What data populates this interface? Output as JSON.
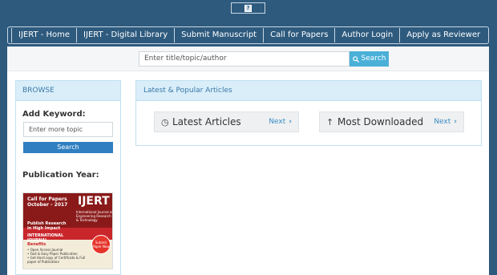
{
  "top_icon": {
    "icon": "help-icon",
    "glyph": "?"
  },
  "nav": {
    "items": [
      {
        "label": "IJERT - Home"
      },
      {
        "label": "IJERT - Digital Library"
      },
      {
        "label": "Submit Manuscript"
      },
      {
        "label": "Call for Papers"
      },
      {
        "label": "Author Login"
      },
      {
        "label": "Apply as Reviewer"
      }
    ]
  },
  "search": {
    "placeholder": "Enter title/topic/author",
    "button_label": "Search",
    "icon": "search-icon"
  },
  "sidebar": {
    "header": "BROWSE",
    "keyword_label": "Add Keyword:",
    "keyword_placeholder": "Enter more topic",
    "search_label": "Search",
    "publication_year_label": "Publication Year:"
  },
  "ad": {
    "call": "Call for Papers\nOctober - 2017",
    "logo": "IJERT",
    "subtitle": "International Journal of Engineering Research & Technology",
    "publish": "Publish Research\nin High Impact",
    "international": "INTERNATIONAL\nJOURNAL",
    "badge": "Submit Paper Now",
    "benefits": "Benefits",
    "list": "• Open Access Journal\n• Fast & Easy Paper Publication\n• Get Hard copy of Certificate & Full paper of Publication"
  },
  "main": {
    "header": "Latest & Popular Articles",
    "tiles": [
      {
        "icon": "clock-icon",
        "glyph": "◷",
        "label": "Latest Articles",
        "next": "Next",
        "chevron": "›"
      },
      {
        "icon": "download-icon",
        "glyph": "↑",
        "label": "Most Downloaded",
        "next": "Next",
        "chevron": "›"
      }
    ]
  }
}
